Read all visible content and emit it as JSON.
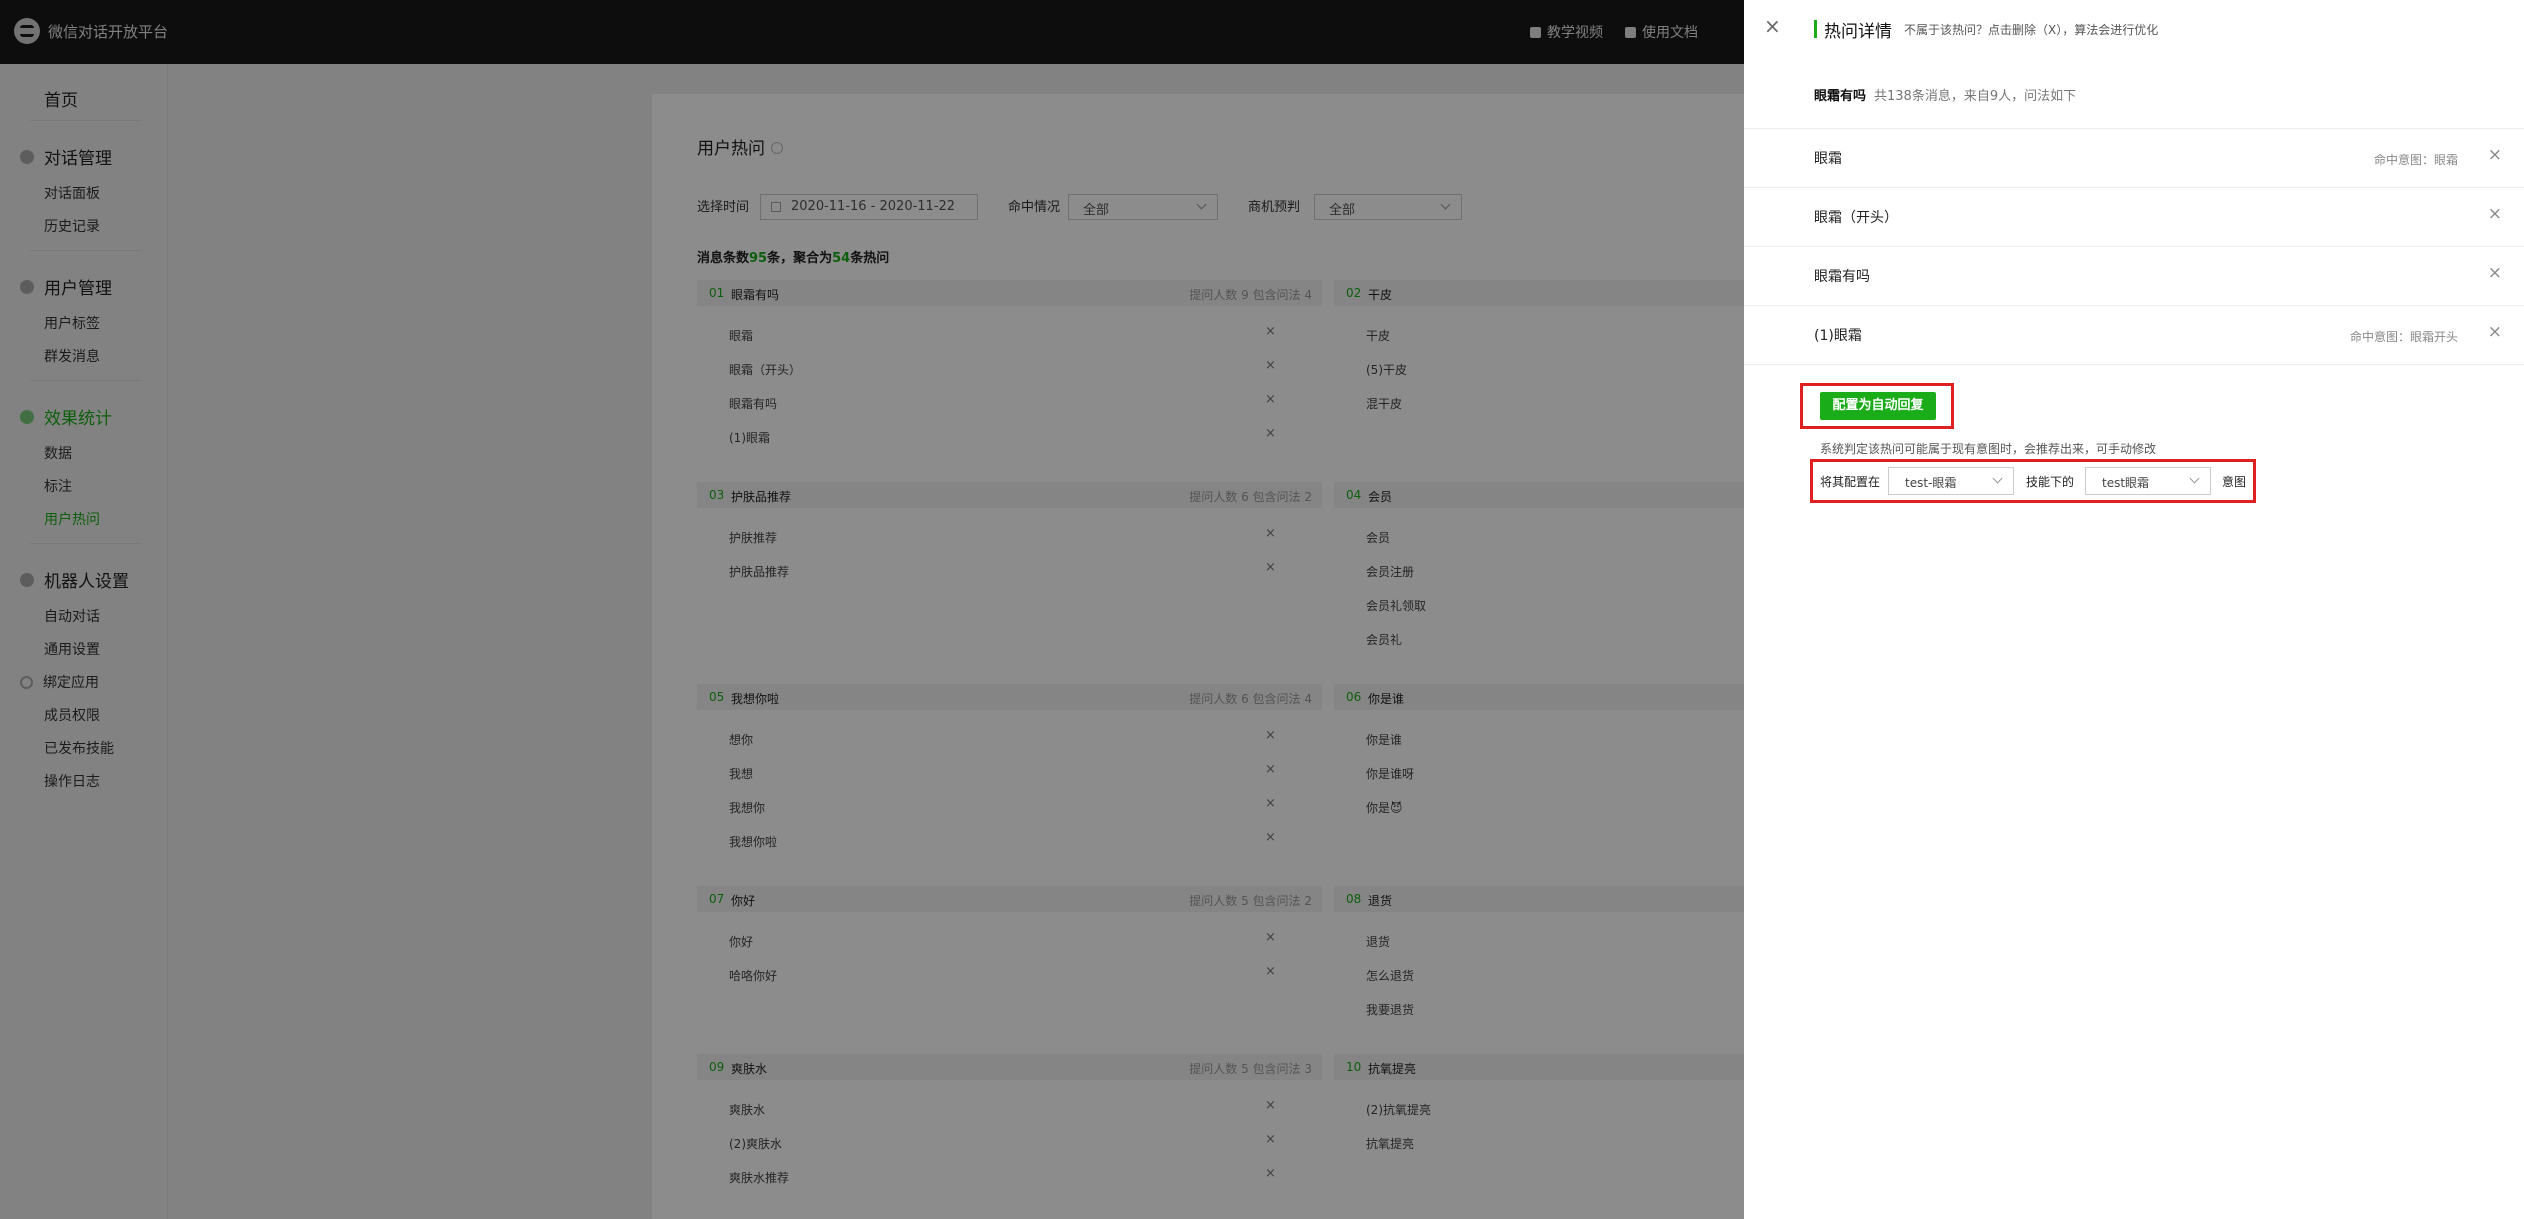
{
  "topbar": {
    "app_title": "微信对话开放平台",
    "nav": [
      {
        "label": "教学视频",
        "icon": "video-icon"
      },
      {
        "label": "使用文档",
        "icon": "doc-icon"
      }
    ]
  },
  "sidebar": {
    "home": "首页",
    "groups": [
      {
        "label": "对话管理",
        "icon": "chat-icon",
        "items": [
          "对话面板",
          "历史记录"
        ]
      },
      {
        "label": "用户管理",
        "icon": "user-icon",
        "items": [
          "用户标签",
          "群发消息"
        ]
      },
      {
        "label": "效果统计",
        "icon": "stats-icon",
        "items": [
          "数据",
          "标注",
          "用户热问"
        ]
      },
      {
        "label": "机器人设置",
        "icon": "gear-icon",
        "items": [
          "自动对话",
          "通用设置",
          "绑定应用",
          "成员权限",
          "已发布技能",
          "操作日志"
        ]
      }
    ],
    "active_item": "用户热问"
  },
  "main": {
    "title": "用户热问",
    "filters": {
      "time_label": "选择时间",
      "date_range": "2020-11-16 - 2020-11-22",
      "hit_label": "命中情况",
      "hit_value": "全部",
      "opp_label": "商机预判",
      "opp_value": "全部"
    },
    "stats": {
      "prefix": "消息条数",
      "messages": "95",
      "mid": "条，聚合为",
      "groups": "54",
      "suffix": "条热问"
    },
    "groups": [
      {
        "num": "01",
        "name": "眼霜有吗",
        "meta": "提问人数 9   包含问法 4",
        "questions": [
          "眼霜",
          "眼霜（开头）",
          "眼霜有吗",
          "(1)眼霜"
        ]
      },
      {
        "num": "02",
        "name": "干皮",
        "meta": "",
        "questions": [
          "干皮",
          "(5)干皮",
          "混干皮"
        ]
      },
      {
        "num": "03",
        "name": "护肤品推荐",
        "meta": "提问人数 6   包含问法 2",
        "questions": [
          "护肤推荐",
          "护肤品推荐"
        ]
      },
      {
        "num": "04",
        "name": "会员",
        "meta": "",
        "questions": [
          "会员",
          "会员注册",
          "会员礼领取",
          "会员礼"
        ]
      },
      {
        "num": "05",
        "name": "我想你啦",
        "meta": "提问人数 6   包含问法 4",
        "questions": [
          "想你",
          "我想",
          "我想你",
          "我想你啦"
        ]
      },
      {
        "num": "06",
        "name": "你是谁",
        "meta": "",
        "questions": [
          "你是谁",
          "你是谁呀",
          "你是😈"
        ]
      },
      {
        "num": "07",
        "name": "你好",
        "meta": "提问人数 5   包含问法 2",
        "questions": [
          "你好",
          "哈咯你好"
        ]
      },
      {
        "num": "08",
        "name": "退货",
        "meta": "",
        "questions": [
          "退货",
          "怎么退货",
          "我要退货"
        ]
      },
      {
        "num": "09",
        "name": "爽肤水",
        "meta": "提问人数 5   包含问法 3",
        "questions": [
          "爽肤水",
          "(2)爽肤水",
          "爽肤水推荐"
        ]
      },
      {
        "num": "10",
        "name": "抗氧提亮",
        "meta": "",
        "questions": [
          "(2)抗氧提亮",
          "抗氧提亮"
        ]
      }
    ]
  },
  "drawer": {
    "close": "×",
    "title": "热问详情",
    "hint": "不属于该热问？点击删除（X），算法会进行优化",
    "summary_title": "眼霜有吗",
    "summary_text": "共138条消息，来自9人，问法如下",
    "questions": [
      {
        "text": "眼霜",
        "intent": "命中意图：眼霜"
      },
      {
        "text": "眼霜（开头）",
        "intent": ""
      },
      {
        "text": "眼霜有吗",
        "intent": ""
      },
      {
        "text": "(1)眼霜",
        "intent": "命中意图：眼霜开头"
      }
    ],
    "config_button": "配置为自动回复",
    "note": "系统判定该热问可能属于现有意图时，会推荐出来，可手动修改",
    "config": {
      "prefix": "将其配置在",
      "skill_value": "test-眼霜",
      "mid": "技能下的",
      "intent_value": "test眼霜",
      "suffix": "意图"
    },
    "highlight_color": "#e02020",
    "accent_color": "#1aad19"
  }
}
